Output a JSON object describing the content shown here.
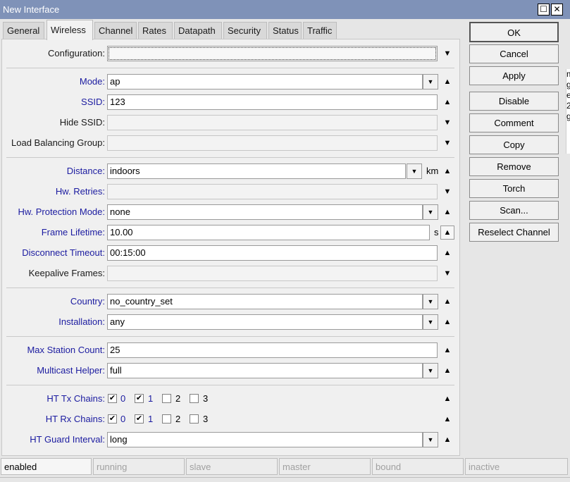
{
  "window": {
    "title": "New Interface",
    "maximize_glyph": "☐",
    "close_glyph": "✕"
  },
  "tabs": [
    "General",
    "Wireless",
    "Channel",
    "Rates",
    "Datapath",
    "Security",
    "Status",
    "Traffic"
  ],
  "active_tab": "Wireless",
  "form": {
    "configuration": {
      "label": "Configuration:",
      "value": ""
    },
    "mode": {
      "label": "Mode:",
      "value": "ap"
    },
    "ssid": {
      "label": "SSID:",
      "value": "123"
    },
    "hide_ssid": {
      "label": "Hide SSID:",
      "value": ""
    },
    "load_balancing_group": {
      "label": "Load Balancing Group:",
      "value": ""
    },
    "distance": {
      "label": "Distance:",
      "value": "indoors",
      "unit": "km"
    },
    "hw_retries": {
      "label": "Hw. Retries:",
      "value": ""
    },
    "hw_protection_mode": {
      "label": "Hw. Protection Mode:",
      "value": "none"
    },
    "frame_lifetime": {
      "label": "Frame Lifetime:",
      "value": "10.00",
      "unit": "s"
    },
    "disconnect_timeout": {
      "label": "Disconnect Timeout:",
      "value": "00:15:00"
    },
    "keepalive_frames": {
      "label": "Keepalive Frames:",
      "value": ""
    },
    "country": {
      "label": "Country:",
      "value": "no_country_set"
    },
    "installation": {
      "label": "Installation:",
      "value": "any"
    },
    "max_station_count": {
      "label": "Max Station Count:",
      "value": "25"
    },
    "multicast_helper": {
      "label": "Multicast Helper:",
      "value": "full"
    },
    "ht_tx_chains": {
      "label": "HT Tx Chains:",
      "options": [
        "0",
        "1",
        "2",
        "3"
      ],
      "checked": [
        true,
        true,
        false,
        false
      ]
    },
    "ht_rx_chains": {
      "label": "HT Rx Chains:",
      "options": [
        "0",
        "1",
        "2",
        "3"
      ],
      "checked": [
        true,
        true,
        false,
        false
      ]
    },
    "ht_guard_interval": {
      "label": "HT Guard Interval:",
      "value": "long"
    }
  },
  "buttons": {
    "ok": "OK",
    "cancel": "Cancel",
    "apply": "Apply",
    "disable": "Disable",
    "comment": "Comment",
    "copy": "Copy",
    "remove": "Remove",
    "torch": "Torch",
    "scan": "Scan...",
    "reselect_channel": "Reselect Channel"
  },
  "status_bar": [
    "enabled",
    "running",
    "slave",
    "master",
    "bound",
    "inactive"
  ],
  "background_window_fragments": [
    "m",
    "g",
    "e",
    "2",
    "g"
  ],
  "glyphs": {
    "dropdown": "▼",
    "up": "▲",
    "down": "▼",
    "check": "✔"
  },
  "colors": {
    "titlebar": "#7f92b8",
    "label_blue": "#1b1ba0"
  }
}
